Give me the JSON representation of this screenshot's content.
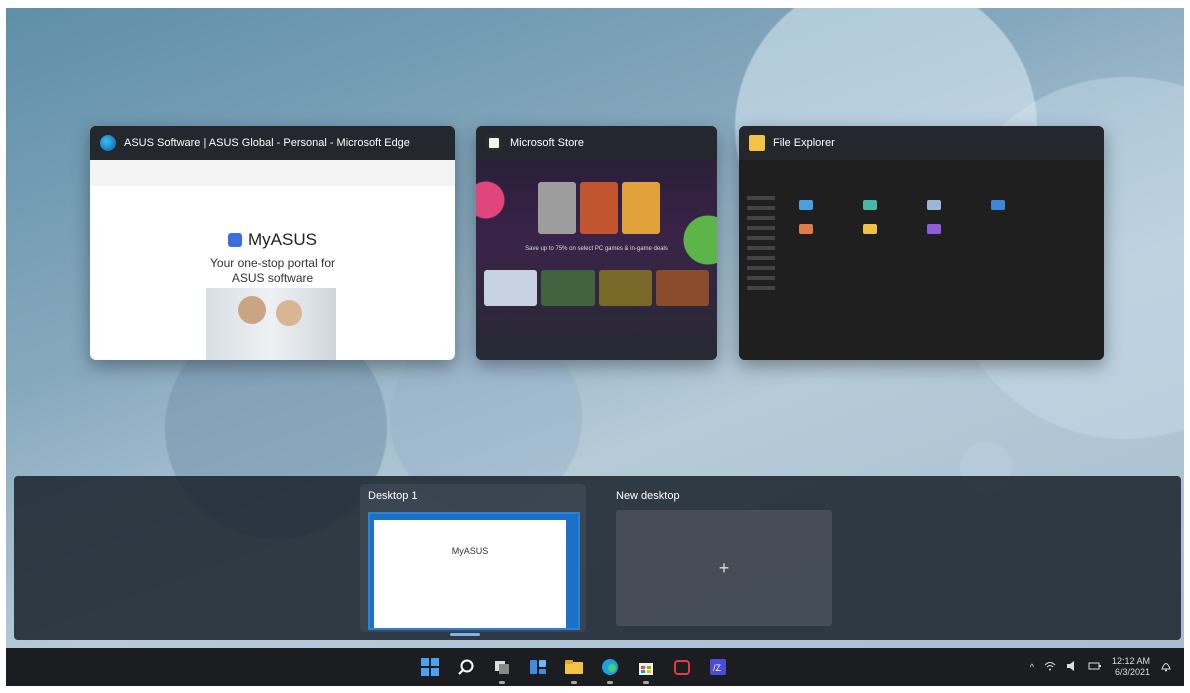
{
  "windows": {
    "edge": {
      "title": "ASUS Software | ASUS Global - Personal - Microsoft Edge",
      "icon": "edge-icon",
      "page_heading": "MyASUS",
      "page_tagline_1": "Your one-stop portal for",
      "page_tagline_2": "ASUS software"
    },
    "store": {
      "title": "Microsoft Store",
      "icon": "store-icon",
      "banner": "Save up to 75% on select PC games & in-game deals"
    },
    "explorer": {
      "title": "File Explorer",
      "icon": "folder-icon"
    }
  },
  "desktops": {
    "items": [
      {
        "label": "Desktop 1",
        "thumb_heading": "MyASUS"
      },
      {
        "label": "New desktop",
        "plus": "+"
      }
    ]
  },
  "taskbar": {
    "icons": [
      "windows-start-icon",
      "search-icon",
      "task-view-icon",
      "widgets-icon",
      "file-explorer-icon",
      "edge-icon",
      "store-icon",
      "myasus-icon",
      "app-icon"
    ],
    "clock_time": "12:12 AM",
    "clock_date": "6/3/2021"
  },
  "colors": {
    "accent": "#2a82d6",
    "taskbar": "#1c1d20"
  }
}
